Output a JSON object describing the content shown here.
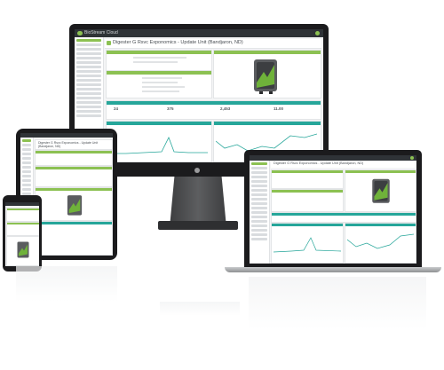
{
  "app": {
    "logo_text": "BioStream Cloud",
    "page_title": "Digester G Rsvc Exponomics - Update Unit (Bandjaron, ND)",
    "mini_page_title": "Digester G Rsvc Exponomics - Update Unit (Bandjaron, ND)"
  },
  "sections": {
    "unit_info": "Unit Information",
    "status": "Unit Status",
    "readings": "Readings",
    "chart_left": "Gas Production",
    "chart_right": "Gas Production"
  },
  "stats": [
    "24",
    "375",
    "2,453",
    "11.00"
  ],
  "colors": {
    "accent_green": "#8cc152",
    "accent_teal": "#26a69a",
    "topbar": "#2f3337",
    "device_body": "#1b1b1d"
  },
  "icons": [
    "cloud-logo-icon",
    "user-avatar-icon",
    "apple-logo-icon"
  ]
}
